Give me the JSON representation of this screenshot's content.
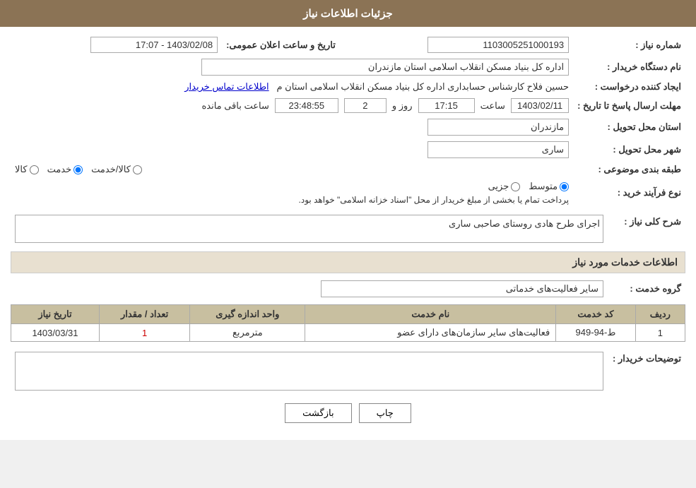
{
  "header": {
    "title": "جزئیات اطلاعات نیاز"
  },
  "fields": {
    "number_label": "شماره نیاز :",
    "number_value": "1103005251000193",
    "purchase_org_label": "نام دستگاه خریدار :",
    "purchase_org_value": "اداره کل بنیاد مسکن انقلاب اسلامی استان مازندران",
    "requester_label": "ایجاد کننده درخواست :",
    "requester_value": "حسین فلاح کارشناس حسابداری اداره کل بنیاد مسکن انقلاب اسلامی استان م",
    "requester_link": "اطلاعات تماس خریدار",
    "deadline_label": "مهلت ارسال پاسخ تا تاریخ :",
    "deadline_date": "1403/02/11",
    "deadline_time_label": "ساعت",
    "deadline_time": "17:15",
    "deadline_days_label": "روز و",
    "deadline_days": "2",
    "deadline_remaining": "23:48:55",
    "deadline_remaining_label": "ساعت باقی مانده",
    "announce_label": "تاریخ و ساعت اعلان عمومی:",
    "announce_value": "1403/02/08 - 17:07",
    "province_label": "استان محل تحویل :",
    "province_value": "مازندران",
    "city_label": "شهر محل تحویل :",
    "city_value": "ساری",
    "category_label": "طبقه بندی موضوعی :",
    "category_options": [
      {
        "id": "kala",
        "label": "کالا"
      },
      {
        "id": "khadamat",
        "label": "خدمت"
      },
      {
        "id": "kala_khadamat",
        "label": "کالا/خدمت"
      }
    ],
    "category_selected": "khadamat",
    "purchase_type_label": "نوع فرآیند خرید :",
    "purchase_type_options": [
      {
        "id": "jozii",
        "label": "جزیی"
      },
      {
        "id": "motavaset",
        "label": "متوسط"
      }
    ],
    "purchase_type_selected": "motavaset",
    "purchase_type_note": "پرداخت تمام یا بخشی از مبلغ خریدار از محل \"اسناد خزانه اسلامی\" خواهد بود."
  },
  "description_section": {
    "title": "شرح کلی نیاز :",
    "value": "اجرای طرح هادی روستای صاحبی ساری"
  },
  "services_section": {
    "title": "اطلاعات خدمات مورد نیاز",
    "group_label": "گروه خدمت :",
    "group_value": "سایر فعالیت‌های خدماتی",
    "table_headers": {
      "row_num": "ردیف",
      "service_code": "کد خدمت",
      "service_name": "نام خدمت",
      "unit": "واحد اندازه گیری",
      "qty": "تعداد / مقدار",
      "date": "تاریخ نیاز"
    },
    "table_rows": [
      {
        "row_num": "1",
        "service_code": "ط-94-949",
        "service_name": "فعالیت‌های سایر سازمان‌های دارای عضو",
        "unit": "مترمربع",
        "qty": "1",
        "date": "1403/03/31"
      }
    ]
  },
  "buyer_notes_label": "توضیحات خریدار :",
  "buyer_notes_value": "",
  "buttons": {
    "print": "چاپ",
    "back": "بازگشت"
  }
}
